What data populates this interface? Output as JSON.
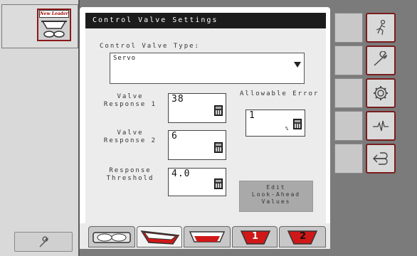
{
  "brand": {
    "logo_text": "New Leader"
  },
  "screen": {
    "title": "Control Valve Settings"
  },
  "control_valve": {
    "type_label": "Control Valve Type:",
    "type_value": "Servo"
  },
  "valve_response_1": {
    "label_line1": "Valve",
    "label_line2": "Response 1",
    "value": "38"
  },
  "valve_response_2": {
    "label_line1": "Valve",
    "label_line2": "Response 2",
    "value": "6"
  },
  "response_threshold": {
    "label_line1": "Response",
    "label_line2": "Threshold",
    "value": "4.0"
  },
  "allowable_error": {
    "label": "Allowable Error",
    "value": "1",
    "unit": "%"
  },
  "edit_lookahead": {
    "line1": "Edit",
    "line2": "Look-Ahead",
    "line3": "Values"
  },
  "bottom_tabs": [
    {
      "icon": "spreader-overhead-icon"
    },
    {
      "icon": "hopper-red-icon"
    },
    {
      "icon": "hopper-side-icon"
    },
    {
      "icon": "bin-1-icon",
      "number": "1"
    },
    {
      "icon": "bin-2-icon",
      "number": "2"
    }
  ],
  "right_buttons": [
    {
      "icon": "operator-run-icon"
    },
    {
      "icon": "wrench-icon"
    },
    {
      "icon": "gear-icon"
    },
    {
      "icon": "diagnostic-waveform-icon"
    },
    {
      "icon": "back-arrow-icon"
    }
  ],
  "colors": {
    "accent": "#8b1a1a",
    "title_bar": "#1c1c1c",
    "panel": "#ececec",
    "hopper_red": "#d01818"
  }
}
